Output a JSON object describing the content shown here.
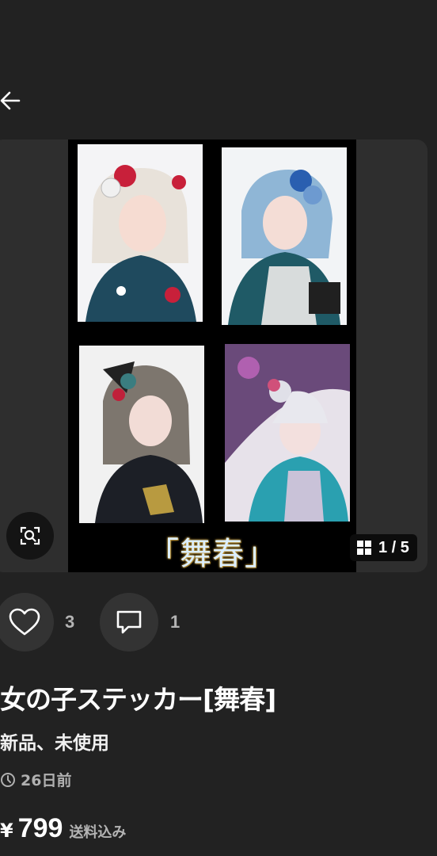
{
  "header": {
    "back_icon": "arrow-left-icon"
  },
  "image": {
    "caption": "「舞春」",
    "counter": "1 / 5",
    "counter_icon": "grid-icon",
    "lens_icon": "image-search-icon"
  },
  "actions": {
    "like_icon": "heart-outline-icon",
    "like_count": "3",
    "comment_icon": "comment-bubble-icon",
    "comment_count": "1"
  },
  "product": {
    "title": "女の子ステッカー[舞春]",
    "condition": "新品、未使用",
    "time_icon": "clock-icon",
    "posted": "26日前",
    "currency": "¥",
    "price": "799",
    "shipping": "送料込み"
  },
  "colors": {
    "background": "#222222",
    "card": "#2e2e2e",
    "button": "#333333",
    "muted_text": "#b4b4b4"
  }
}
